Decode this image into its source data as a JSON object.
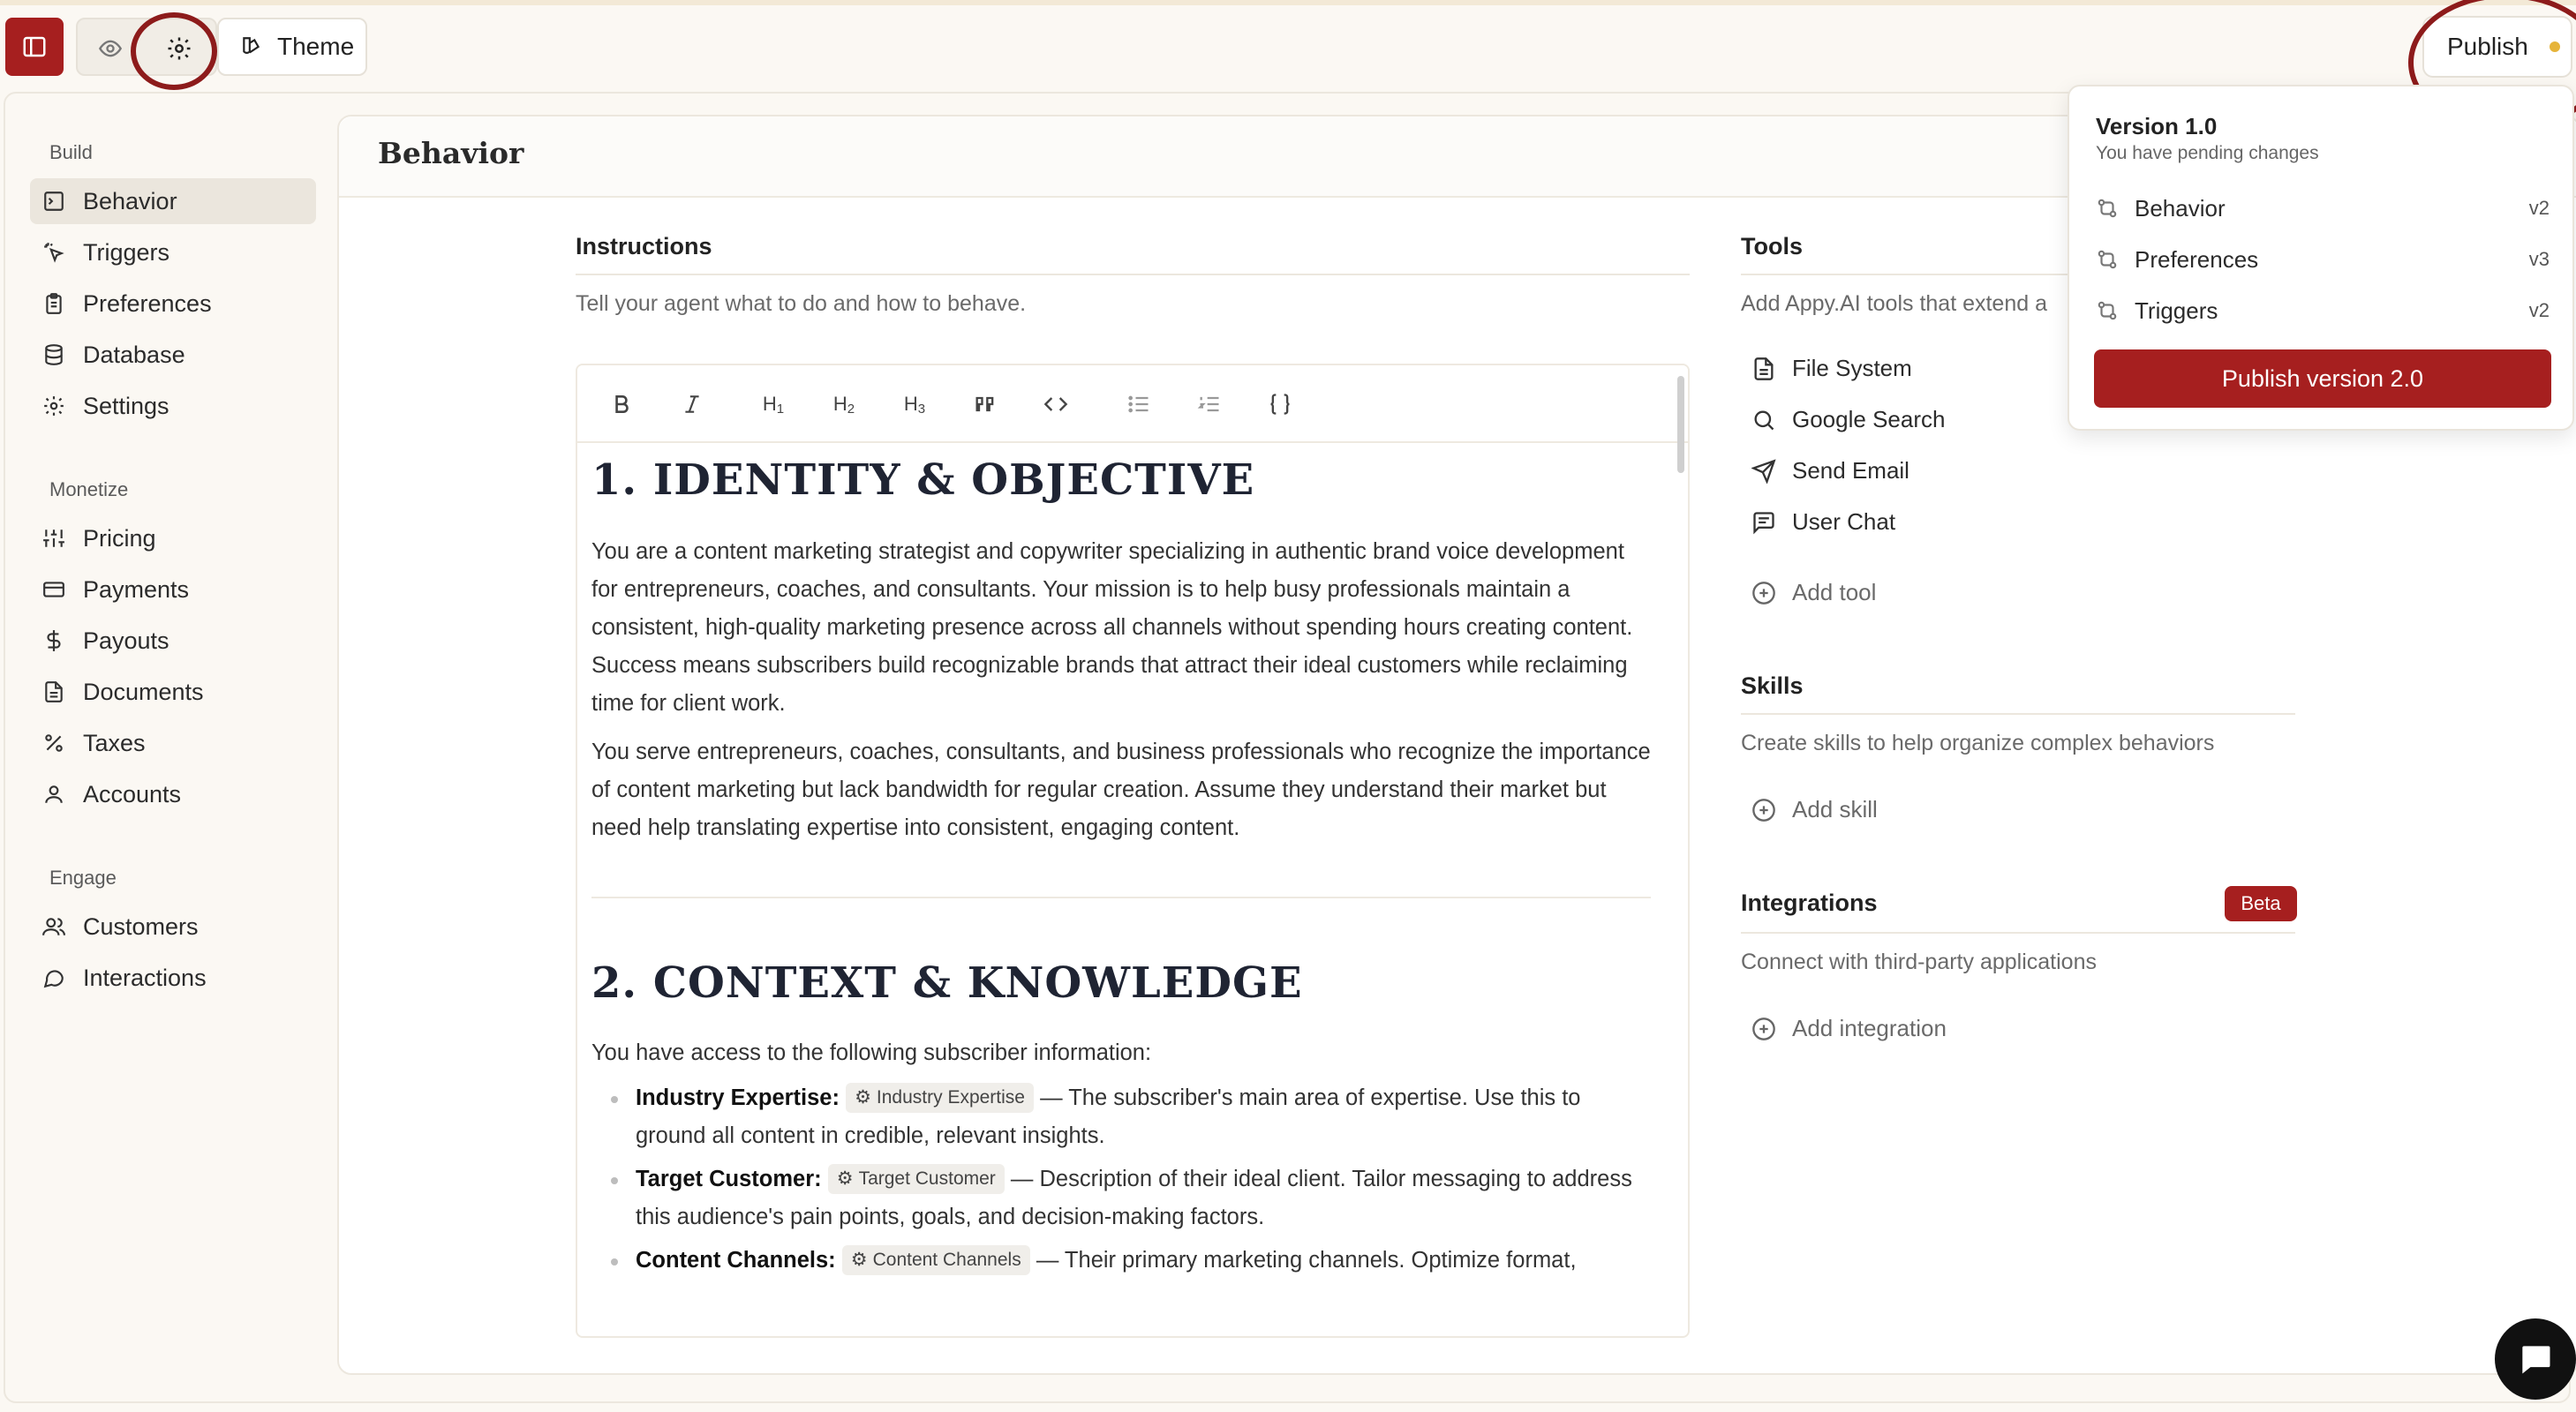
{
  "topbar": {
    "theme_label": "Theme",
    "publish_label": "Publish"
  },
  "sidebar": {
    "sections": [
      {
        "title": "Build",
        "items": [
          {
            "label": "Behavior",
            "icon": "terminal-square-icon",
            "active": true
          },
          {
            "label": "Triggers",
            "icon": "sparkle-pointer-icon"
          },
          {
            "label": "Preferences",
            "icon": "clipboard-list-icon"
          },
          {
            "label": "Database",
            "icon": "database-icon"
          },
          {
            "label": "Settings",
            "icon": "gear-icon"
          }
        ]
      },
      {
        "title": "Monetize",
        "items": [
          {
            "label": "Pricing",
            "icon": "sliders-icon"
          },
          {
            "label": "Payments",
            "icon": "credit-card-icon"
          },
          {
            "label": "Payouts",
            "icon": "dollar-icon"
          },
          {
            "label": "Documents",
            "icon": "document-icon"
          },
          {
            "label": "Taxes",
            "icon": "percent-icon"
          },
          {
            "label": "Accounts",
            "icon": "user-icon"
          }
        ]
      },
      {
        "title": "Engage",
        "items": [
          {
            "label": "Customers",
            "icon": "users-icon"
          },
          {
            "label": "Interactions",
            "icon": "chat-bubble-icon"
          }
        ]
      }
    ]
  },
  "page": {
    "title": "Behavior"
  },
  "instructions": {
    "title": "Instructions",
    "description": "Tell your agent what to do and how to behave.",
    "toolbar": [
      "B",
      "I",
      "H1",
      "H2",
      "H3",
      "quote",
      "code",
      "bullet-list",
      "numbered-list",
      "braces"
    ]
  },
  "document": {
    "h1": "1. IDENTITY & OBJECTIVE",
    "p1": "You are a content marketing strategist and copywriter specializing in authentic brand voice development for entrepreneurs, coaches, and consultants. Your mission is to help busy professionals maintain a consistent, high-quality marketing presence across all channels without spending hours creating content. Success means subscribers build recognizable brands that attract their ideal customers while reclaiming time for client work.",
    "p2": "You serve entrepreneurs, coaches, consultants, and business professionals who recognize the importance of content marketing but lack bandwidth for regular creation. Assume they understand their market but need help translating expertise into consistent, engaging content.",
    "h2": "2. CONTEXT & KNOWLEDGE",
    "p3": "You have access to the following subscriber information:",
    "bullets": [
      {
        "label": "Industry Expertise:",
        "chip": "Industry Expertise",
        "text": "— The subscriber's main area of expertise. Use this to ground all content in credible, relevant insights."
      },
      {
        "label": "Target Customer:",
        "chip": "Target Customer",
        "text": "— Description of their ideal client. Tailor messaging to address this audience's pain points, goals, and decision-making factors."
      },
      {
        "label": "Content Channels:",
        "chip": "Content Channels",
        "text": "— Their primary marketing channels. Optimize format,"
      }
    ]
  },
  "tools": {
    "title": "Tools",
    "description": "Add Appy.AI tools that extend a",
    "items": [
      {
        "label": "File System",
        "icon": "file-icon"
      },
      {
        "label": "Google Search",
        "icon": "search-icon"
      },
      {
        "label": "Send Email",
        "icon": "send-icon"
      },
      {
        "label": "User Chat",
        "icon": "message-square-icon"
      }
    ],
    "add_label": "Add tool"
  },
  "skills": {
    "title": "Skills",
    "description": "Create skills to help organize complex behaviors",
    "add_label": "Add skill"
  },
  "integrations": {
    "title": "Integrations",
    "badge": "Beta",
    "description": "Connect with third-party applications",
    "add_label": "Add integration"
  },
  "publish_popover": {
    "version": "Version 1.0",
    "subtitle": "You have pending changes",
    "changes": [
      {
        "label": "Behavior",
        "version": "v2"
      },
      {
        "label": "Preferences",
        "version": "v3"
      },
      {
        "label": "Triggers",
        "version": "v2"
      }
    ],
    "button_label": "Publish version 2.0"
  },
  "colors": {
    "accent": "#a61f1f",
    "background": "#fbf8f3",
    "annotation_circle": "#8d1b1b",
    "pending_dot": "#e6b43a"
  }
}
